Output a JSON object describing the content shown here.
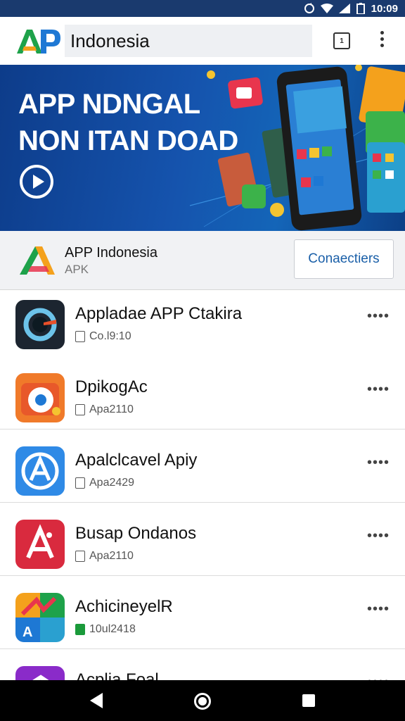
{
  "status_bar": {
    "time": "10:09"
  },
  "toolbar": {
    "search_value": "Indonesia",
    "tab_count": "1"
  },
  "banner": {
    "title_line1": "APP NDNGAL",
    "title_line2": "NON ITAN DOAD"
  },
  "info": {
    "title": "APP Indonesia",
    "subtitle": "APK",
    "button_label": "Conaectiers"
  },
  "apps": [
    {
      "name": "Appladae APP Ctakira",
      "meta": "Co.l9:10",
      "icon": "dark-circle-icon"
    },
    {
      "name": "DpikogAc",
      "meta": "Apa2110",
      "icon": "orange-eye-icon"
    },
    {
      "name": "Apalclcavel Apiy",
      "meta": "Apa2429",
      "icon": "blue-a-icon"
    },
    {
      "name": "Busap Ondanos",
      "meta": "Apa2110",
      "icon": "red-a-icon"
    },
    {
      "name": "AchicineyelR",
      "meta": "10ul2418",
      "icon": "colorful-a-icon"
    },
    {
      "name": "Acplia Foal",
      "meta": "",
      "icon": "purple-icon"
    }
  ],
  "colors": {
    "status_bar": "#1a3a6e",
    "banner_blue": "#1553ad",
    "accent_blue": "#1a5fa8"
  }
}
